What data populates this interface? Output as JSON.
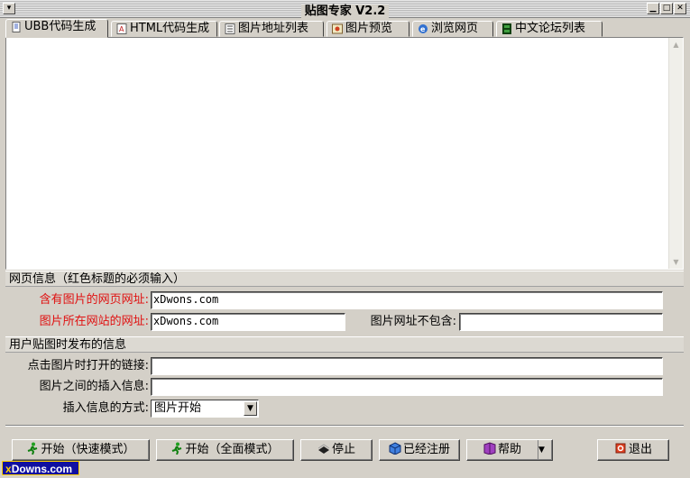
{
  "window": {
    "title": "贴图专家 V2.2"
  },
  "tabs": [
    {
      "label": "UBB代码生成",
      "icon": "document-icon"
    },
    {
      "label": "HTML代码生成",
      "icon": "html-icon"
    },
    {
      "label": "图片地址列表",
      "icon": "list-icon"
    },
    {
      "label": "图片预览",
      "icon": "picture-icon"
    },
    {
      "label": "浏览网页",
      "icon": "ie-icon"
    },
    {
      "label": "中文论坛列表",
      "icon": "film-icon"
    }
  ],
  "web_info": {
    "header": "网页信息（红色标题的必须输入）",
    "page_url_label": "含有图片的网页网址:",
    "page_url_value": "xDwons.com",
    "site_url_label": "图片所在网站的网址:",
    "site_url_value": "xDwons.com",
    "exclude_label": "图片网址不包含:",
    "exclude_value": ""
  },
  "post_info": {
    "header": "用户贴图时发布的信息",
    "link_label": "点击图片时打开的链接:",
    "link_value": "",
    "insert_label": "图片之间的插入信息:",
    "insert_value": "",
    "mode_label": "插入信息的方式:",
    "mode_value": "图片开始"
  },
  "buttons": {
    "start_fast": "开始（快速模式）",
    "start_full": "开始（全面模式）",
    "stop": "停止",
    "registered": "已经注册",
    "help": "帮助",
    "exit": "退出"
  },
  "watermark": {
    "prefix": "x",
    "text": "Downs.com"
  },
  "colors": {
    "required_label": "#e01010",
    "window_bg": "#d4d0c8"
  }
}
